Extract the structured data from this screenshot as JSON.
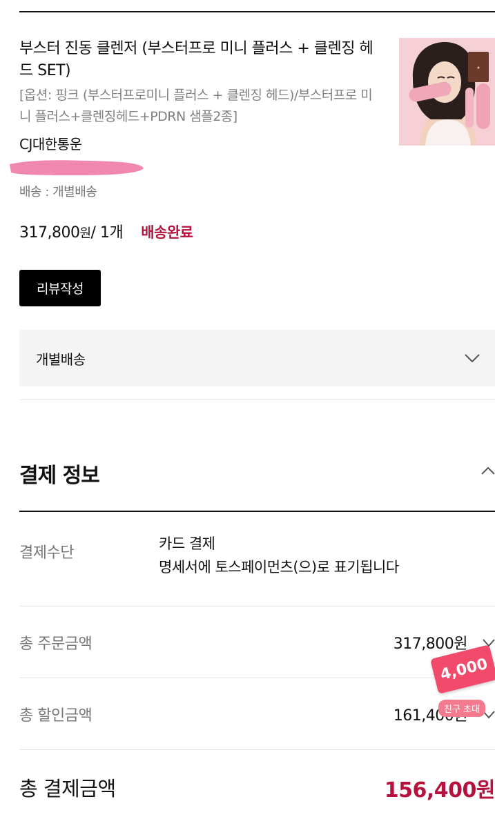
{
  "order_item": {
    "title": "부스터 진동 클렌저 (부스터프로 미니 플러스 + 클렌징 헤드 SET)",
    "option": "[옵션: 핑크 (부스터프로미니 플러스 + 클렌징 헤드)/부스터프로 미니 플러스+클렌징헤드+PDRN 샘플2종]",
    "carrier": "CJ대한통운",
    "shipping_type": "배송 : 개별배송",
    "price": "317,800",
    "currency": "원",
    "quantity": " / 1개",
    "status": "배송완료",
    "review_button": "리뷰작성"
  },
  "shipping_accordion": {
    "label": "개별배송"
  },
  "payment": {
    "section_title": "결제 정보",
    "method_label": "결제수단",
    "method_value_line1": "카드 결제",
    "method_value_line2": "명세서에 토스페이먼츠(으)로 표기됩니다",
    "total_order_label": "총 주문금액",
    "total_order_value": "317,800원",
    "total_discount_label": "총 할인금액",
    "total_discount_value": "161,400원",
    "total_pay_label": "총 결제금액",
    "total_pay_value": "156,400원"
  },
  "promo": {
    "amount": "4,000",
    "label": "친구 초대"
  },
  "colors": {
    "accent": "#b5123e",
    "promo": "#f24a6a",
    "button": "#000000"
  }
}
